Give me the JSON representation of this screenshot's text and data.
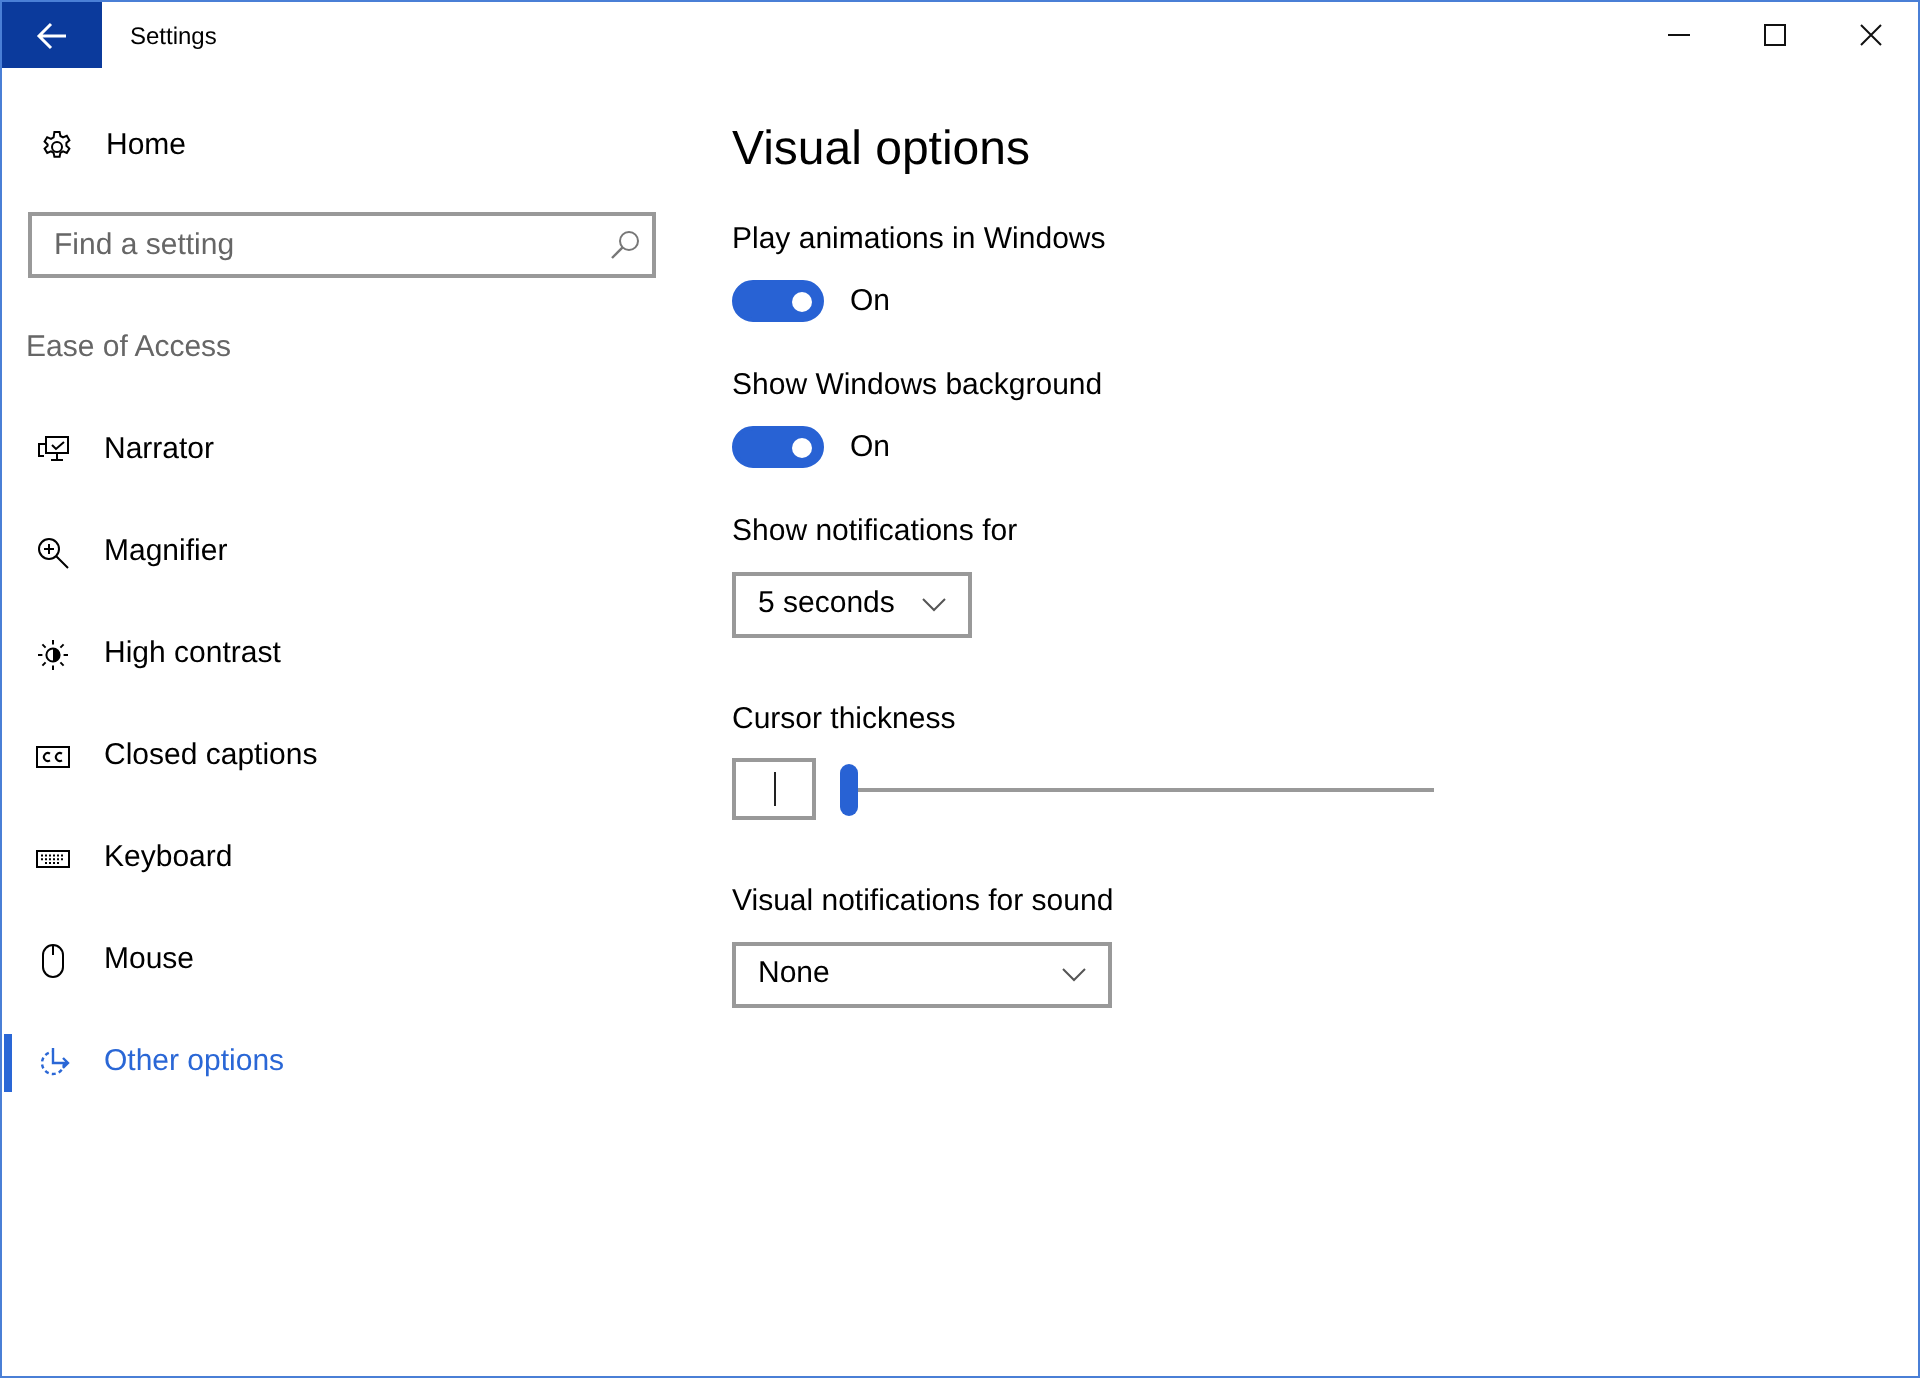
{
  "window": {
    "title": "Settings"
  },
  "sidebar": {
    "home": {
      "label": "Home"
    },
    "search": {
      "placeholder": "Find a setting"
    },
    "section_title": "Ease of Access",
    "items": [
      {
        "label": "Narrator",
        "selected": false
      },
      {
        "label": "Magnifier",
        "selected": false
      },
      {
        "label": "High contrast",
        "selected": false
      },
      {
        "label": "Closed captions",
        "selected": false
      },
      {
        "label": "Keyboard",
        "selected": false
      },
      {
        "label": "Mouse",
        "selected": false
      },
      {
        "label": "Other options",
        "selected": true
      }
    ]
  },
  "main": {
    "title": "Visual options",
    "settings": [
      {
        "kind": "toggle",
        "label": "Play animations in Windows",
        "on": true,
        "state_label": "On"
      },
      {
        "kind": "toggle",
        "label": "Show Windows background",
        "on": true,
        "state_label": "On"
      },
      {
        "kind": "dropdown",
        "label": "Show notifications for",
        "value": "5 seconds"
      },
      {
        "kind": "slider",
        "label": "Cursor thickness",
        "level": 0
      },
      {
        "kind": "dropdown",
        "label": "Visual notifications for sound",
        "value": "None"
      }
    ]
  }
}
